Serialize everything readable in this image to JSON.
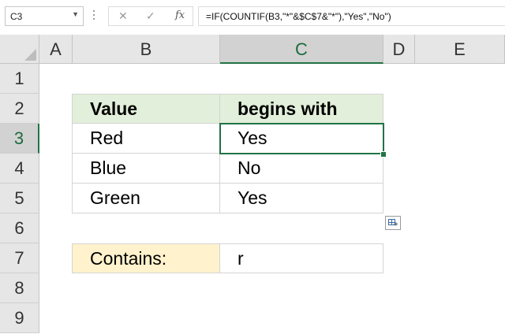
{
  "formula_bar": {
    "name_box": "C3",
    "cancel_icon": "✕",
    "enter_icon": "✓",
    "fx_label": "fx",
    "formula": "=IF(COUNTIF(B3,\"*\"&$C$7&\"*\"),\"Yes\",\"No\")"
  },
  "columns": [
    "A",
    "B",
    "C",
    "D",
    "E"
  ],
  "rows": [
    "1",
    "2",
    "3",
    "4",
    "5",
    "6",
    "7",
    "8",
    "9"
  ],
  "table": {
    "header": {
      "value": "Value",
      "begins_with": "begins with"
    },
    "rows": [
      {
        "value": "Red",
        "result": "Yes"
      },
      {
        "value": "Blue",
        "result": "No"
      },
      {
        "value": "Green",
        "result": "Yes"
      }
    ]
  },
  "contains": {
    "label": "Contains:",
    "value": "r"
  },
  "selection": {
    "cell": "C3",
    "column": "C",
    "row": "3"
  },
  "colors": {
    "accent": "#217346",
    "header_fill": "#e2efda",
    "contains_fill": "#fff2cc",
    "header_bg": "#e6e6e6"
  }
}
